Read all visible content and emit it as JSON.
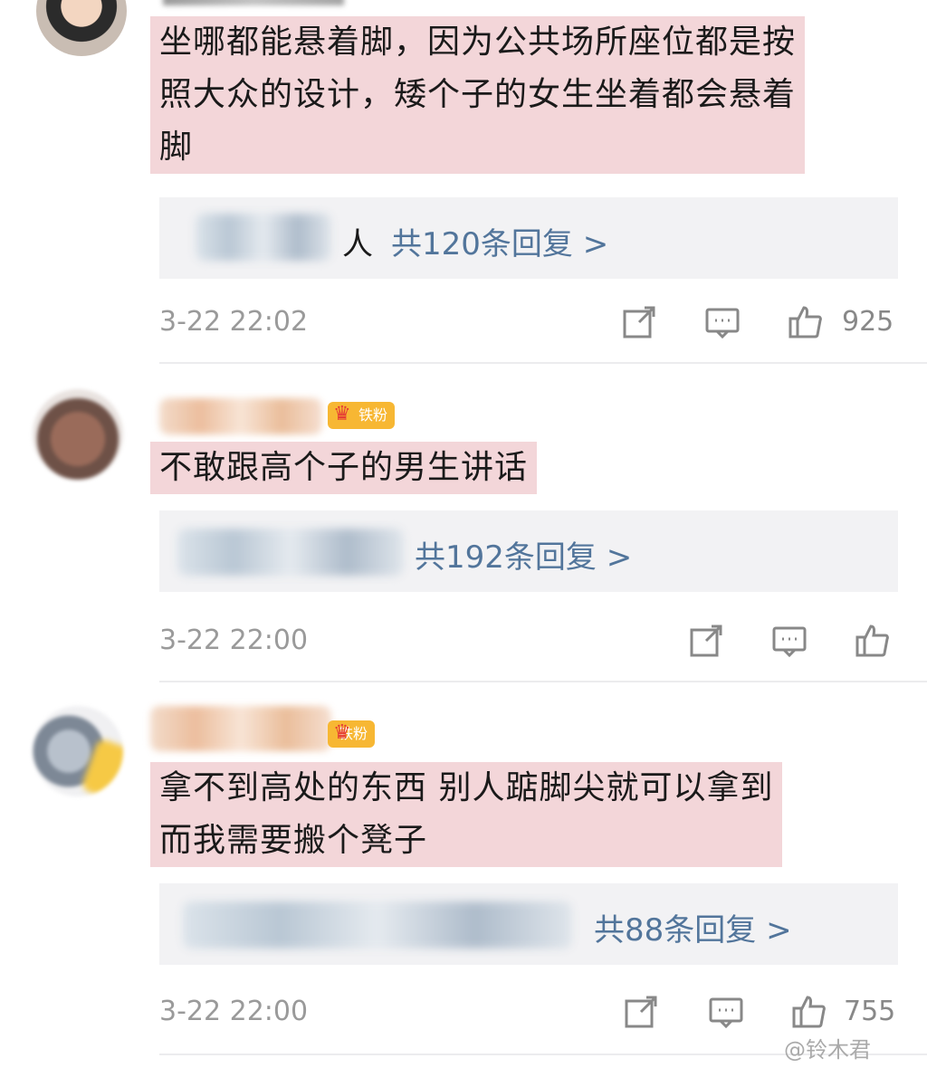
{
  "comments": [
    {
      "lines": [
        "坐哪都能悬着脚，因为公共场所座位都是按",
        "照大众的设计，矮个子的女生坐着都会悬着",
        "脚"
      ],
      "reply_user": "人",
      "reply_link": "共120条回复 >",
      "time": "3-22 22:02",
      "like_count": "925"
    },
    {
      "badge": "铁粉",
      "lines": [
        "不敢跟高个子的男生讲话"
      ],
      "reply_link": "共192条回复 >",
      "time": "3-22 22:00",
      "like_count": ""
    },
    {
      "badge": "铁粉",
      "lines": [
        "拿不到高处的东西 别人踮脚尖就可以拿到",
        "而我需要搬个凳子"
      ],
      "reply_link": "共88条回复 >",
      "time": "3-22 22:00",
      "like_count": "755"
    }
  ],
  "watermark": "@铃木君",
  "icons": [
    "share-icon",
    "comment-icon",
    "like-icon"
  ],
  "colors": {
    "highlight": "#f3d6d9",
    "reply_link": "#52759b",
    "badge": "#f7b733"
  }
}
